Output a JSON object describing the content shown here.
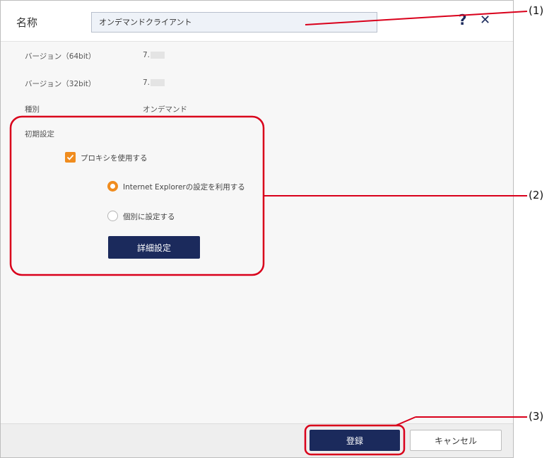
{
  "header": {
    "name_label": "名称",
    "name_value": "オンデマンドクライアント",
    "help_glyph": "?",
    "close_glyph": "✕"
  },
  "info": {
    "version64_label": "バージョン（64bit）",
    "version64_value": "7.",
    "version32_label": "バージョン（32bit）",
    "version32_value": "7.",
    "type_label": "種別",
    "type_value": "オンデマンド"
  },
  "initial_settings": {
    "section_label": "初期設定",
    "use_proxy_label": "プロキシを使用する",
    "use_proxy_checked": true,
    "radio_ie_label": "Internet Explorerの設定を利用する",
    "radio_ie_selected": true,
    "radio_custom_label": "個別に設定する",
    "radio_custom_selected": false,
    "detail_button": "詳細設定"
  },
  "footer": {
    "register_button": "登録",
    "cancel_button": "キャンセル"
  },
  "annotations": {
    "callout_1": "(1)",
    "callout_2": "(2)",
    "callout_3": "(3)",
    "highlight_color": "#d9001b"
  },
  "colors": {
    "accent_orange": "#f08c1e",
    "primary_navy": "#1b2a5c"
  }
}
